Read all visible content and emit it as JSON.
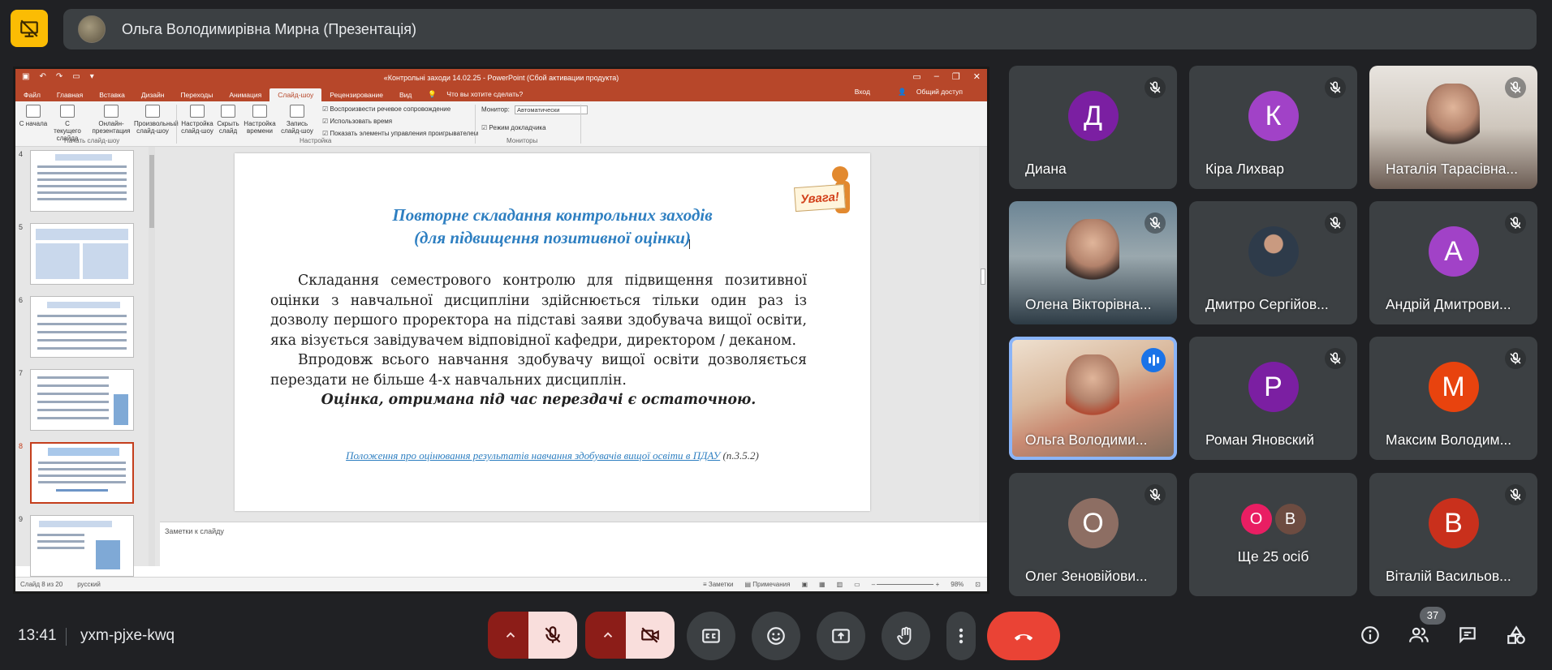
{
  "presenter": {
    "name": "Ольга Володимирівна Мирна (Презентація)"
  },
  "powerpoint": {
    "title": "«Контрольні заходи 14.02.25 - PowerPoint (Сбой активации продукта)",
    "tabs": [
      "Файл",
      "Главная",
      "Вставка",
      "Дизайн",
      "Переходы",
      "Анимация",
      "Слайд-шоу",
      "Рецензирование",
      "Вид"
    ],
    "tell_me": "Что вы хотите сделать?",
    "login": "Вход",
    "share": "Общий доступ",
    "ribbon_buttons": [
      {
        "label": "С начала"
      },
      {
        "label": "С текущего слайда"
      },
      {
        "label": "Онлайн-презентация"
      },
      {
        "label": "Произвольный слайд-шоу"
      },
      {
        "label": "Настройка слайд-шоу"
      },
      {
        "label": "Скрыть слайд"
      },
      {
        "label": "Настройка времени"
      },
      {
        "label": "Запись слайд-шоу"
      }
    ],
    "ribbon_checks": [
      "Воспроизвести речевое сопровождение",
      "Использовать время",
      "Показать элементы управления проигрывателем"
    ],
    "ribbon_groups": [
      "Начать слайд-шоу",
      "Настройка",
      "Мониторы"
    ],
    "monitor_label": "Монитор:",
    "monitor_value": "Автоматически",
    "presenter_mode": "Режим докладчика",
    "thumb_numbers": [
      "4",
      "5",
      "6",
      "7",
      "8",
      "9"
    ],
    "slide": {
      "title_line1": "Повторне складання контрольних заходів",
      "title_line2": "(для підвищення позитивної оцінки)",
      "para1": "Складання семестрового контролю для підвищення позитивної оцінки з навчальної дисципліни здійснюється тільки один раз із дозволу першого проректора на підставі заяви здобувача вищої освіти, яка візується завідувачем відповідної кафедри, директором / деканом.",
      "para2": "Впродовж всього навчання здобувачу вищої освіти дозволяється перездати не більше 4-х навчальних дисциплін.",
      "para3": "Оцінка, отримана під час перездачі є остаточною.",
      "link_text": "Положення про оцінювання результатів навчання здобувачів вищої освіти в ПДАУ",
      "link_ref": "(п.3.5.2)",
      "sign": "Увага!"
    },
    "notes_placeholder": "Заметки к слайду",
    "status": {
      "slide_of": "Слайд 8 из 20",
      "language": "русский",
      "notes_btn": "Заметки",
      "comments_btn": "Примечания",
      "zoom": "98%"
    }
  },
  "participants": [
    {
      "name": "Диана",
      "initial": "Д",
      "color": "#7b1fa2",
      "kind": "avatar"
    },
    {
      "name": "Кіра Лихвар",
      "initial": "К",
      "color": "#a142c7",
      "kind": "avatar"
    },
    {
      "name": "Наталія Тарасівна...",
      "kind": "video"
    },
    {
      "name": "Олена Вікторівна...",
      "kind": "video"
    },
    {
      "name": "Дмитро Сергійов...",
      "kind": "photo"
    },
    {
      "name": "Андрій Дмитрови...",
      "initial": "А",
      "color": "#a142c7",
      "kind": "avatar"
    },
    {
      "name": "Ольга Володими...",
      "kind": "video"
    },
    {
      "name": "Роман Яновский",
      "initial": "Р",
      "color": "#7b1fa2",
      "kind": "avatar"
    },
    {
      "name": "Максим Володим...",
      "initial": "М",
      "color": "#e8430e",
      "kind": "avatar"
    },
    {
      "name": "Олег Зеновійови...",
      "initial": "О",
      "color": "#8d6e63",
      "kind": "avatar"
    },
    {
      "name": "Ще 25 осіб",
      "kind": "more",
      "mini": [
        {
          "initial": "О",
          "color": "#e91e63"
        },
        {
          "initial": "В",
          "color": "#6d4c41"
        }
      ]
    },
    {
      "name": "Віталій Васильов...",
      "initial": "В",
      "color": "#c9301c",
      "kind": "avatar"
    }
  ],
  "meeting": {
    "time": "13:41",
    "code": "yxm-pjxe-kwq",
    "participant_count": "37"
  }
}
